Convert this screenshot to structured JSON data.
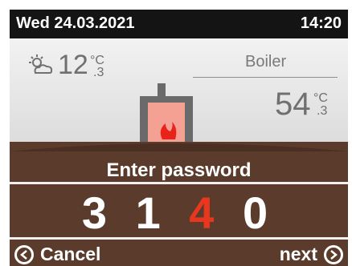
{
  "status": {
    "date": "Wed  24.03.2021",
    "time": "14:20"
  },
  "weather": {
    "icon": "partly-cloudy-icon",
    "temp_value": "12",
    "deg_unit": "°C",
    "deg_decimal": ".3"
  },
  "boiler": {
    "label": "Boiler",
    "temp_value": "54",
    "deg_unit": "°C",
    "deg_decimal": ".3",
    "icon": "boiler-flame-icon"
  },
  "dialog": {
    "title": "Enter password",
    "digits": [
      "3",
      "1",
      "4",
      "0"
    ],
    "active_digit_index": 2,
    "cancel_label": "Cancel",
    "next_label": "next"
  },
  "colors": {
    "dialog_bg": "#5a3b2c",
    "accent": "#e8371f",
    "status_bar": "#141414"
  }
}
